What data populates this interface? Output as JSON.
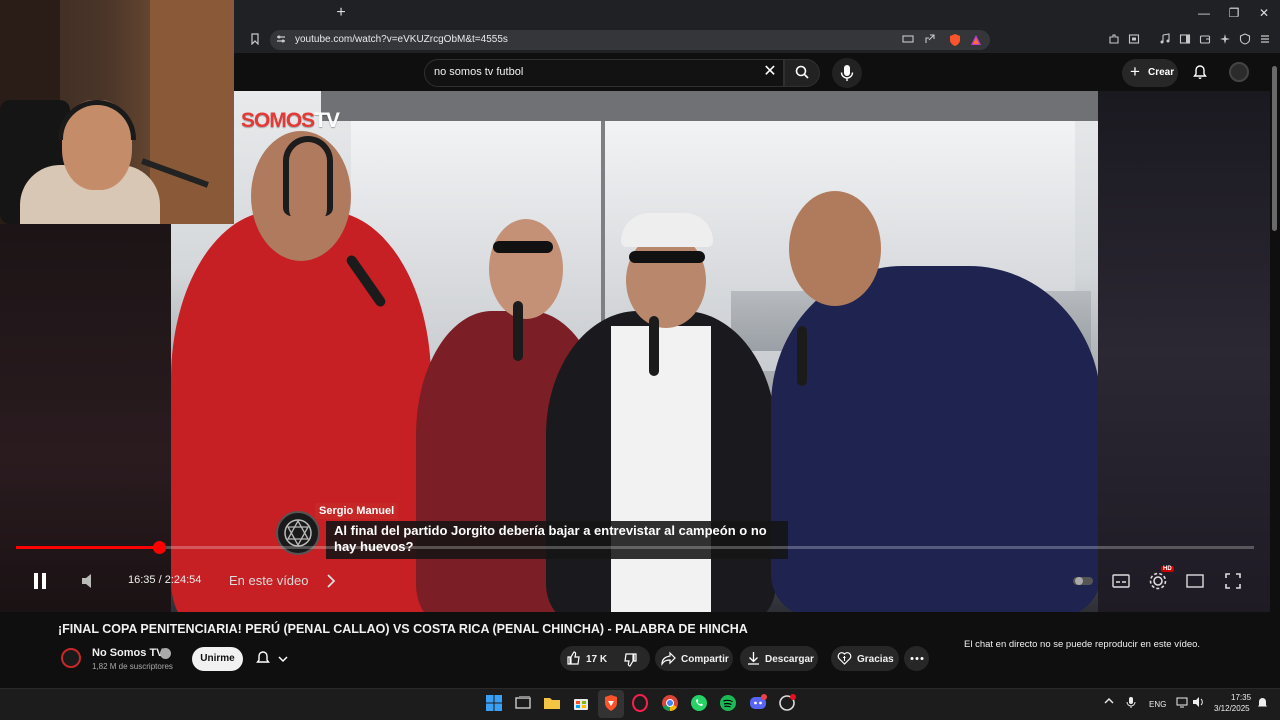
{
  "browser": {
    "url": "youtube.com/watch?v=eVKUZrcgObM&t=4555s"
  },
  "youtube": {
    "search_query": "no somos tv futbol",
    "create_label": "Crear"
  },
  "video": {
    "logo_red": "SOMOS",
    "logo_white": "TV",
    "caption_name": "Sergio Manuel",
    "caption_text": "Al final del partido Jorgito debería bajar a entrevistar al campeón o no hay huevos?",
    "progress": 0.1158
  },
  "player": {
    "time": "16:35 / 2:24:54",
    "chapter_label": "En este vídeo",
    "hd_label": "HD"
  },
  "watch": {
    "title": "¡FINAL COPA PENITENCIARIA! PERÚ (PENAL CALLAO) VS COSTA RICA (PENAL CHINCHA) - PALABRA DE HINCHA",
    "channel_name": "No Somos TV",
    "subscribers": "1,82 M de suscriptores",
    "join_label": "Unirme",
    "like_count": "17 K",
    "share_label": "Compartir",
    "download_label": "Descargar",
    "thanks_label": "Gracias",
    "chat_disabled": "El chat en directo no se puede reproducir en este vídeo."
  },
  "taskbar": {
    "language": "ENG",
    "time": "17:35",
    "date": "3/12/2025"
  },
  "colors": {
    "youtube_red": "#ff0000",
    "brand_red": "#c62828",
    "background": "#0f0f0f"
  }
}
